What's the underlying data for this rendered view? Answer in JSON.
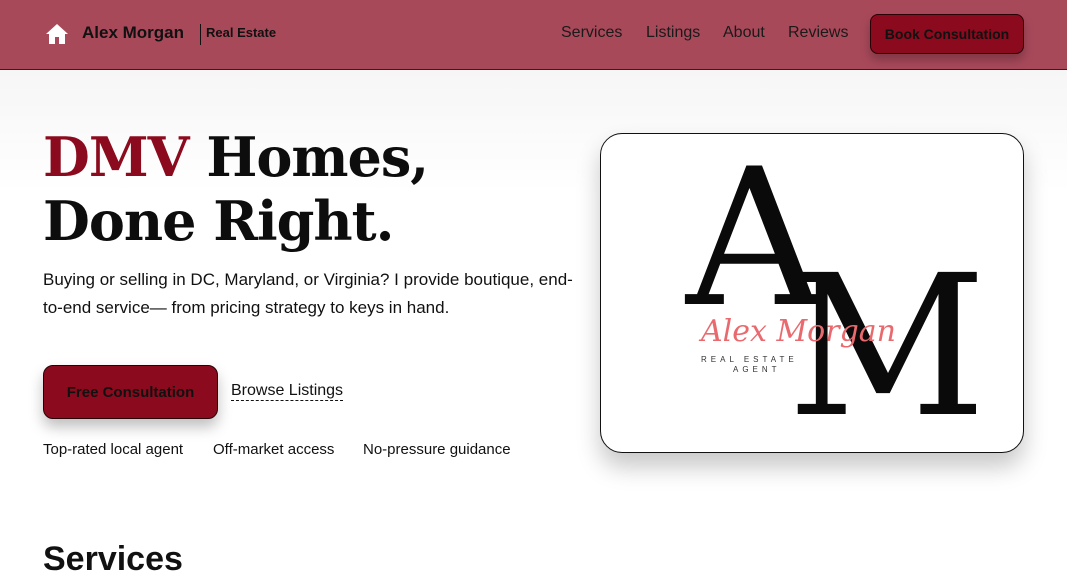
{
  "header": {
    "brand_name": "Alex Morgan",
    "brand_tag": "Real Estate",
    "nav": [
      "Services",
      "Listings",
      "About",
      "Reviews"
    ],
    "cta_label": "Book Consultation",
    "home_icon": "home-icon"
  },
  "hero": {
    "title_accent": "DMV",
    "title_rest": "Homes, Done Right.",
    "subtitle": "Buying or selling in DC, Maryland, or Virginia? I provide boutique, end-to-end service— from pricing strategy to keys in hand.",
    "primary_cta": "Free Consultation",
    "secondary_cta": "Browse Listings",
    "badges": [
      "Top-rated local agent",
      "Off-market access",
      "No-pressure guidance"
    ]
  },
  "logo": {
    "letter_a": "A",
    "letter_m": "M",
    "script_name": "Alex Morgan",
    "line1": "REAL ESTATE",
    "line2": "AGENT"
  },
  "sections": {
    "services_heading": "Services"
  },
  "colors": {
    "header_bg": "#a8495a",
    "accent": "#8b0a1d",
    "script_pink": "#e86a6e"
  }
}
